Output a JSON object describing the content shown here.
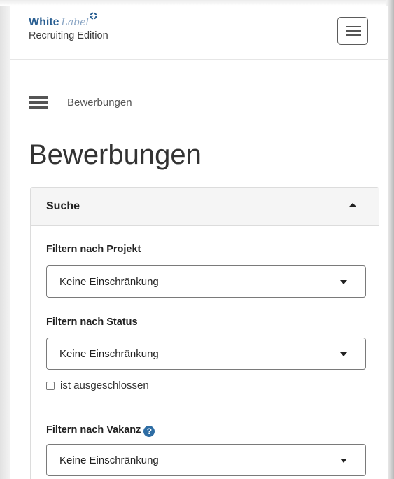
{
  "header": {
    "brand_white": "White",
    "brand_label": "Label",
    "brand_edition": "Recruiting Edition",
    "menu_icon": "hamburger-icon"
  },
  "breadcrumb": {
    "menu_icon": "hamburger-icon",
    "current": "Bewerbungen"
  },
  "page_title": "Bewerbungen",
  "search_panel": {
    "title": "Suche",
    "toggle_icon": "caret-up-icon",
    "filters": {
      "projekt": {
        "label": "Filtern nach Projekt",
        "selected": "Keine Einschränkung"
      },
      "status": {
        "label": "Filtern nach Status",
        "selected": "Keine Einschränkung",
        "exclude_checkbox_label": "ist ausgeschlossen",
        "exclude_checked": false
      },
      "vakanz": {
        "label": "Filtern nach Vakanz",
        "help_icon": "question-circle-icon",
        "selected": "Keine Einschränkung"
      }
    }
  },
  "colors": {
    "brand_blue": "#2a5f92",
    "help_blue": "#2e6da4",
    "panel_header_bg": "#f5f5f5",
    "text_dark": "#222222"
  }
}
